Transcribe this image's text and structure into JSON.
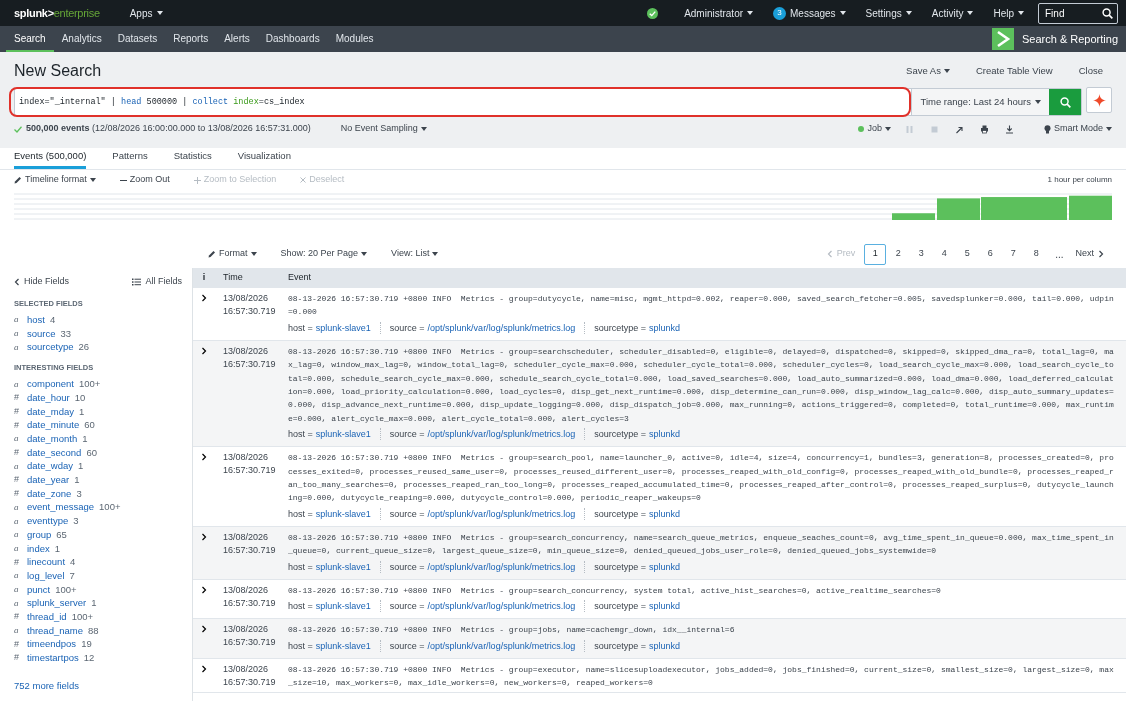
{
  "top_bar": {
    "logo": {
      "brand": "splunk>",
      "product": "enterprise"
    },
    "apps_menu": "Apps",
    "status_ok": true,
    "menus": [
      {
        "label": "Administrator",
        "kind": "menu"
      },
      {
        "label": "Messages",
        "kind": "badge_menu",
        "badge": "3"
      },
      {
        "label": "Settings",
        "kind": "menu"
      },
      {
        "label": "Activity",
        "kind": "menu"
      },
      {
        "label": "Help",
        "kind": "menu"
      }
    ],
    "find": {
      "placeholder": "Find"
    }
  },
  "app_nav": {
    "items": [
      {
        "label": "Search",
        "selected": true
      },
      {
        "label": "Analytics",
        "selected": false
      },
      {
        "label": "Datasets",
        "selected": false
      },
      {
        "label": "Reports",
        "selected": false
      },
      {
        "label": "Alerts",
        "selected": false
      },
      {
        "label": "Dashboards",
        "selected": false
      },
      {
        "label": "Modules",
        "selected": false
      }
    ],
    "app_name": "Search & Reporting"
  },
  "search": {
    "title": "New Search",
    "actions": [
      {
        "label": "Save As",
        "kind": "menu"
      },
      {
        "label": "Create Table View",
        "kind": "link"
      },
      {
        "label": "Close",
        "kind": "link"
      }
    ],
    "query": {
      "highlighted": true,
      "tokens": [
        {
          "text": "index=\"_internal\" | ",
          "kind": "plain"
        },
        {
          "text": "head",
          "kind": "command"
        },
        {
          "text": " 500000 | ",
          "kind": "plain"
        },
        {
          "text": "collect ",
          "kind": "command"
        },
        {
          "text": "index",
          "kind": "argument"
        },
        {
          "text": "=cs_index",
          "kind": "plain"
        }
      ]
    },
    "time_range": "Time range: Last 24 hours"
  },
  "job_status": {
    "summary": "**500,000 events** (12/08/2026 16:00:00.000 to 13/08/2026 16:57:31.000)",
    "sampling": "No Event Sampling",
    "job": "Job",
    "mode": "Smart Mode"
  },
  "result_tabs": [
    {
      "label": "Events (500,000)",
      "selected": true
    },
    {
      "label": "Patterns",
      "selected": false
    },
    {
      "label": "Statistics",
      "selected": false
    },
    {
      "label": "Visualization",
      "selected": false
    }
  ],
  "timeline": {
    "tools": [
      {
        "label": "Timeline format",
        "kind": "format",
        "disabled": false
      },
      {
        "label": "Zoom Out",
        "kind": "minus",
        "disabled": false
      },
      {
        "label": "Zoom to Selection",
        "kind": "plus",
        "disabled": true
      },
      {
        "label": "Deselect",
        "kind": "cross",
        "disabled": true
      }
    ],
    "scale": "1 hour per column"
  },
  "results_bar": {
    "format": "Format",
    "per_page": "Show: 20 Per Page",
    "view": "View: List",
    "prev": {
      "label": "Prev",
      "disabled": true
    },
    "pages": [
      {
        "label": "1",
        "selected": true
      },
      {
        "label": "2",
        "selected": false
      },
      {
        "label": "3",
        "selected": false
      },
      {
        "label": "4",
        "selected": false
      },
      {
        "label": "5",
        "selected": false
      },
      {
        "label": "6",
        "selected": false
      },
      {
        "label": "7",
        "selected": false
      },
      {
        "label": "8",
        "selected": false
      }
    ],
    "ellipsis": "...",
    "next": {
      "label": "Next",
      "disabled": false
    }
  },
  "sidebar": {
    "hide_fields": "Hide Fields",
    "all_fields": "All Fields",
    "sections": [
      {
        "title": "SELECTED FIELDS",
        "fields": [
          {
            "type": "a",
            "name": "host",
            "count": "4"
          },
          {
            "type": "a",
            "name": "source",
            "count": "33"
          },
          {
            "type": "a",
            "name": "sourcetype",
            "count": "26"
          }
        ]
      },
      {
        "title": "INTERESTING FIELDS",
        "fields": [
          {
            "type": "a",
            "name": "component",
            "count": "100+"
          },
          {
            "type": "#",
            "name": "date_hour",
            "count": "10"
          },
          {
            "type": "#",
            "name": "date_mday",
            "count": "1"
          },
          {
            "type": "#",
            "name": "date_minute",
            "count": "60"
          },
          {
            "type": "a",
            "name": "date_month",
            "count": "1"
          },
          {
            "type": "#",
            "name": "date_second",
            "count": "60"
          },
          {
            "type": "a",
            "name": "date_wday",
            "count": "1"
          },
          {
            "type": "#",
            "name": "date_year",
            "count": "1"
          },
          {
            "type": "#",
            "name": "date_zone",
            "count": "3"
          },
          {
            "type": "a",
            "name": "event_message",
            "count": "100+"
          },
          {
            "type": "a",
            "name": "eventtype",
            "count": "3"
          },
          {
            "type": "a",
            "name": "group",
            "count": "65"
          },
          {
            "type": "a",
            "name": "index",
            "count": "1"
          },
          {
            "type": "#",
            "name": "linecount",
            "count": "4"
          },
          {
            "type": "a",
            "name": "log_level",
            "count": "7"
          },
          {
            "type": "a",
            "name": "punct",
            "count": "100+"
          },
          {
            "type": "a",
            "name": "splunk_server",
            "count": "1"
          },
          {
            "type": "#",
            "name": "thread_id",
            "count": "100+"
          },
          {
            "type": "a",
            "name": "thread_name",
            "count": "88"
          },
          {
            "type": "#",
            "name": "timeendpos",
            "count": "19"
          },
          {
            "type": "#",
            "name": "timestartpos",
            "count": "12"
          }
        ]
      }
    ],
    "more_fields": "752 more fields"
  },
  "events_table": {
    "columns": [
      "i",
      "Time",
      "Event"
    ],
    "rows": [
      {
        "date": "13/08/2026",
        "time": "16:57:30.719",
        "event": "08-13-2026 16:57:30.719 +0800 INFO  Metrics - group=dutycycle, name=misc, mgmt_httpd=0.002, reaper=0.000, saved_search_fetcher=0.005, savedsplunker=0.000, tail=0.000, udpin=0.000",
        "fields": [
          {
            "key": "host =",
            "value": "splunk-slave1"
          },
          {
            "key": "source =",
            "value": "/opt/splunk/var/log/splunk/metrics.log"
          },
          {
            "key": "sourcetype =",
            "value": "splunkd"
          }
        ]
      },
      {
        "date": "13/08/2026",
        "time": "16:57:30.719",
        "event": "08-13-2026 16:57:30.719 +0800 INFO  Metrics - group=searchscheduler, scheduler_disabled=0, eligible=0, delayed=0, dispatched=0, skipped=0, skipped_dma_ra=0, total_lag=0, max_lag=0, window_max_lag=0, window_total_lag=0, scheduler_cycle_max=0.000, scheduler_cycle_total=0.000, scheduler_cycles=0, load_search_cycle_max=0.000, load_search_cycle_total=0.000, schedule_search_cycle_max=0.000, schedule_search_cycle_total=0.000, load_saved_searches=0.000, load_auto_summarized=0.000, load_dma=0.000, load_deferred_calculation=0.000, load_priority_calculation=0.000, load_cycles=0, disp_get_next_runtime=0.000, disp_determine_can_run=0.000, disp_window_lag_calc=0.000, disp_auto_summary_updates=0.000, disp_advance_next_runtime=0.000, disp_update_logging=0.000, disp_dispatch_job=0.000, max_running=0, actions_triggered=0, completed=0, total_runtime=0.000, max_runtime=0.000, alert_cycle_max=0.000, alert_cycle_total=0.000, alert_cycles=3",
        "fields": [
          {
            "key": "host =",
            "value": "splunk-slave1"
          },
          {
            "key": "source =",
            "value": "/opt/splunk/var/log/splunk/metrics.log"
          },
          {
            "key": "sourcetype =",
            "value": "splunkd"
          }
        ]
      },
      {
        "date": "13/08/2026",
        "time": "16:57:30.719",
        "event": "08-13-2026 16:57:30.719 +0800 INFO  Metrics - group=search_pool, name=launcher_0, active=0, idle=4, size=4, concurrency=1, bundles=3, generation=8, processes_created=0, processes_exited=0, processes_reused_same_user=0, processes_reused_different_user=0, processes_reaped_with_old_config=0, processes_reaped_with_old_bundle=0, processes_reaped_ran_too_many_searches=0, processes_reaped_ran_too_long=0, processes_reaped_accumulated_time=0, processes_reaped_after_control=0, processes_reaped_surplus=0, dutycycle_launching=0.000, dutycycle_reaping=0.000, dutycycle_control=0.000, periodic_reaper_wakeups=0",
        "fields": [
          {
            "key": "host =",
            "value": "splunk-slave1"
          },
          {
            "key": "source =",
            "value": "/opt/splunk/var/log/splunk/metrics.log"
          },
          {
            "key": "sourcetype =",
            "value": "splunkd"
          }
        ]
      },
      {
        "date": "13/08/2026",
        "time": "16:57:30.719",
        "event": "08-13-2026 16:57:30.719 +0800 INFO  Metrics - group=search_concurrency, name=search_queue_metrics, enqueue_seaches_count=0, avg_time_spent_in_queue=0.000, max_time_spent_in_queue=0, current_queue_size=0, largest_queue_size=0, min_queue_size=0, denied_queued_jobs_user_role=0, denied_queued_jobs_systemwide=0",
        "fields": [
          {
            "key": "host =",
            "value": "splunk-slave1"
          },
          {
            "key": "source =",
            "value": "/opt/splunk/var/log/splunk/metrics.log"
          },
          {
            "key": "sourcetype =",
            "value": "splunkd"
          }
        ]
      },
      {
        "date": "13/08/2026",
        "time": "16:57:30.719",
        "event": "08-13-2026 16:57:30.719 +0800 INFO  Metrics - group=search_concurrency, system total, active_hist_searches=0, active_realtime_searches=0",
        "fields": [
          {
            "key": "host =",
            "value": "splunk-slave1"
          },
          {
            "key": "source =",
            "value": "/opt/splunk/var/log/splunk/metrics.log"
          },
          {
            "key": "sourcetype =",
            "value": "splunkd"
          }
        ]
      },
      {
        "date": "13/08/2026",
        "time": "16:57:30.719",
        "event": "08-13-2026 16:57:30.719 +0800 INFO  Metrics - group=jobs, name=cachemgr_down, idx__internal=6",
        "fields": [
          {
            "key": "host =",
            "value": "splunk-slave1"
          },
          {
            "key": "source =",
            "value": "/opt/splunk/var/log/splunk/metrics.log"
          },
          {
            "key": "sourcetype =",
            "value": "splunkd"
          }
        ]
      },
      {
        "date": "13/08/2026",
        "time": "16:57:30.719",
        "event": "08-13-2026 16:57:30.719 +0800 INFO  Metrics - group=executor, name=slicesuploadexecutor, jobs_added=0, jobs_finished=0, current_size=0, smallest_size=0, largest_size=0, max_size=10, max_workers=0, max_idle_workers=0, new_workers=0, reaped_workers=0"
      }
    ]
  }
}
